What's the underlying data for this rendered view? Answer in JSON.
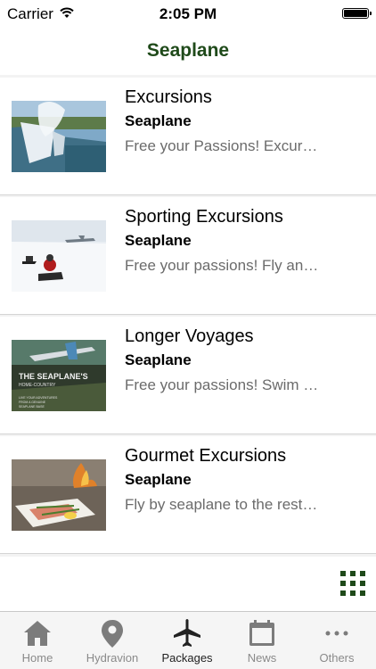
{
  "status_bar": {
    "carrier": "Carrier",
    "time": "2:05 PM"
  },
  "nav": {
    "title": "Seaplane"
  },
  "colors": {
    "accent": "#1f4a1a",
    "separator": "#d4d4d4",
    "tab_active": "#222222",
    "tab_inactive": "#8a8a8a"
  },
  "items": [
    {
      "title": "Excursions",
      "subtitle": "Seaplane",
      "description": "Free your Passions! Excursions by seaplane",
      "image": "waterfall-photo"
    },
    {
      "title": "Sporting Excursions",
      "subtitle": "Seaplane",
      "description": "Free your passions! Fly and ride",
      "image": "snowmobile-photo"
    },
    {
      "title": "Longer Voyages",
      "subtitle": "Seaplane",
      "description": "Free your passions! Swim and explore",
      "image": "seaplane-brochure-photo"
    },
    {
      "title": "Gourmet Excursions",
      "subtitle": "Seaplane",
      "description": "Fly by seaplane to the restaurant",
      "image": "gourmet-dish-photo"
    }
  ],
  "view_toggle": {
    "icon": "grid-view-icon"
  },
  "tabs": [
    {
      "label": "Home",
      "icon": "home-icon",
      "active": false
    },
    {
      "label": "Hydravion",
      "icon": "map-pin-icon",
      "active": false
    },
    {
      "label": "Packages",
      "icon": "airplane-icon",
      "active": true
    },
    {
      "label": "News",
      "icon": "calendar-icon",
      "active": false
    },
    {
      "label": "Others",
      "icon": "more-icon",
      "active": false
    }
  ]
}
